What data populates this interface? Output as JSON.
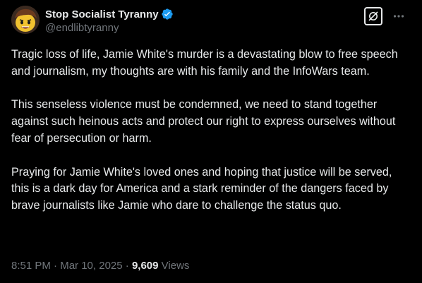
{
  "author": {
    "display_name": "Stop Socialist Tyranny",
    "handle": "@endlibtyranny",
    "verified": true,
    "avatar_icon": "lego-figure-avatar"
  },
  "actions": {
    "grok_icon": "grok-icon",
    "more_icon": "more-dots-icon"
  },
  "tweet": {
    "paragraphs": [
      "Tragic loss of life, Jamie White's murder is a devastating blow to free speech and journalism, my thoughts are with his family and the InfoWars team.",
      "This senseless violence must be condemned, we need to stand together against such heinous acts and protect our right to express ourselves without fear of persecution or harm.",
      "Praying for Jamie White's loved ones and hoping that justice will be served, this is a dark day for America and a stark reminder of the dangers faced by brave journalists like Jamie who dare to challenge the status quo."
    ]
  },
  "meta": {
    "time": "8:51 PM",
    "separator1": " · ",
    "date": "Mar 10, 2025",
    "separator2": " · ",
    "views_count": "9,609",
    "views_label": " Views"
  },
  "colors": {
    "background": "#000000",
    "text": "#e7e9ea",
    "secondary": "#71767b",
    "verified_blue": "#1d9bf0"
  }
}
